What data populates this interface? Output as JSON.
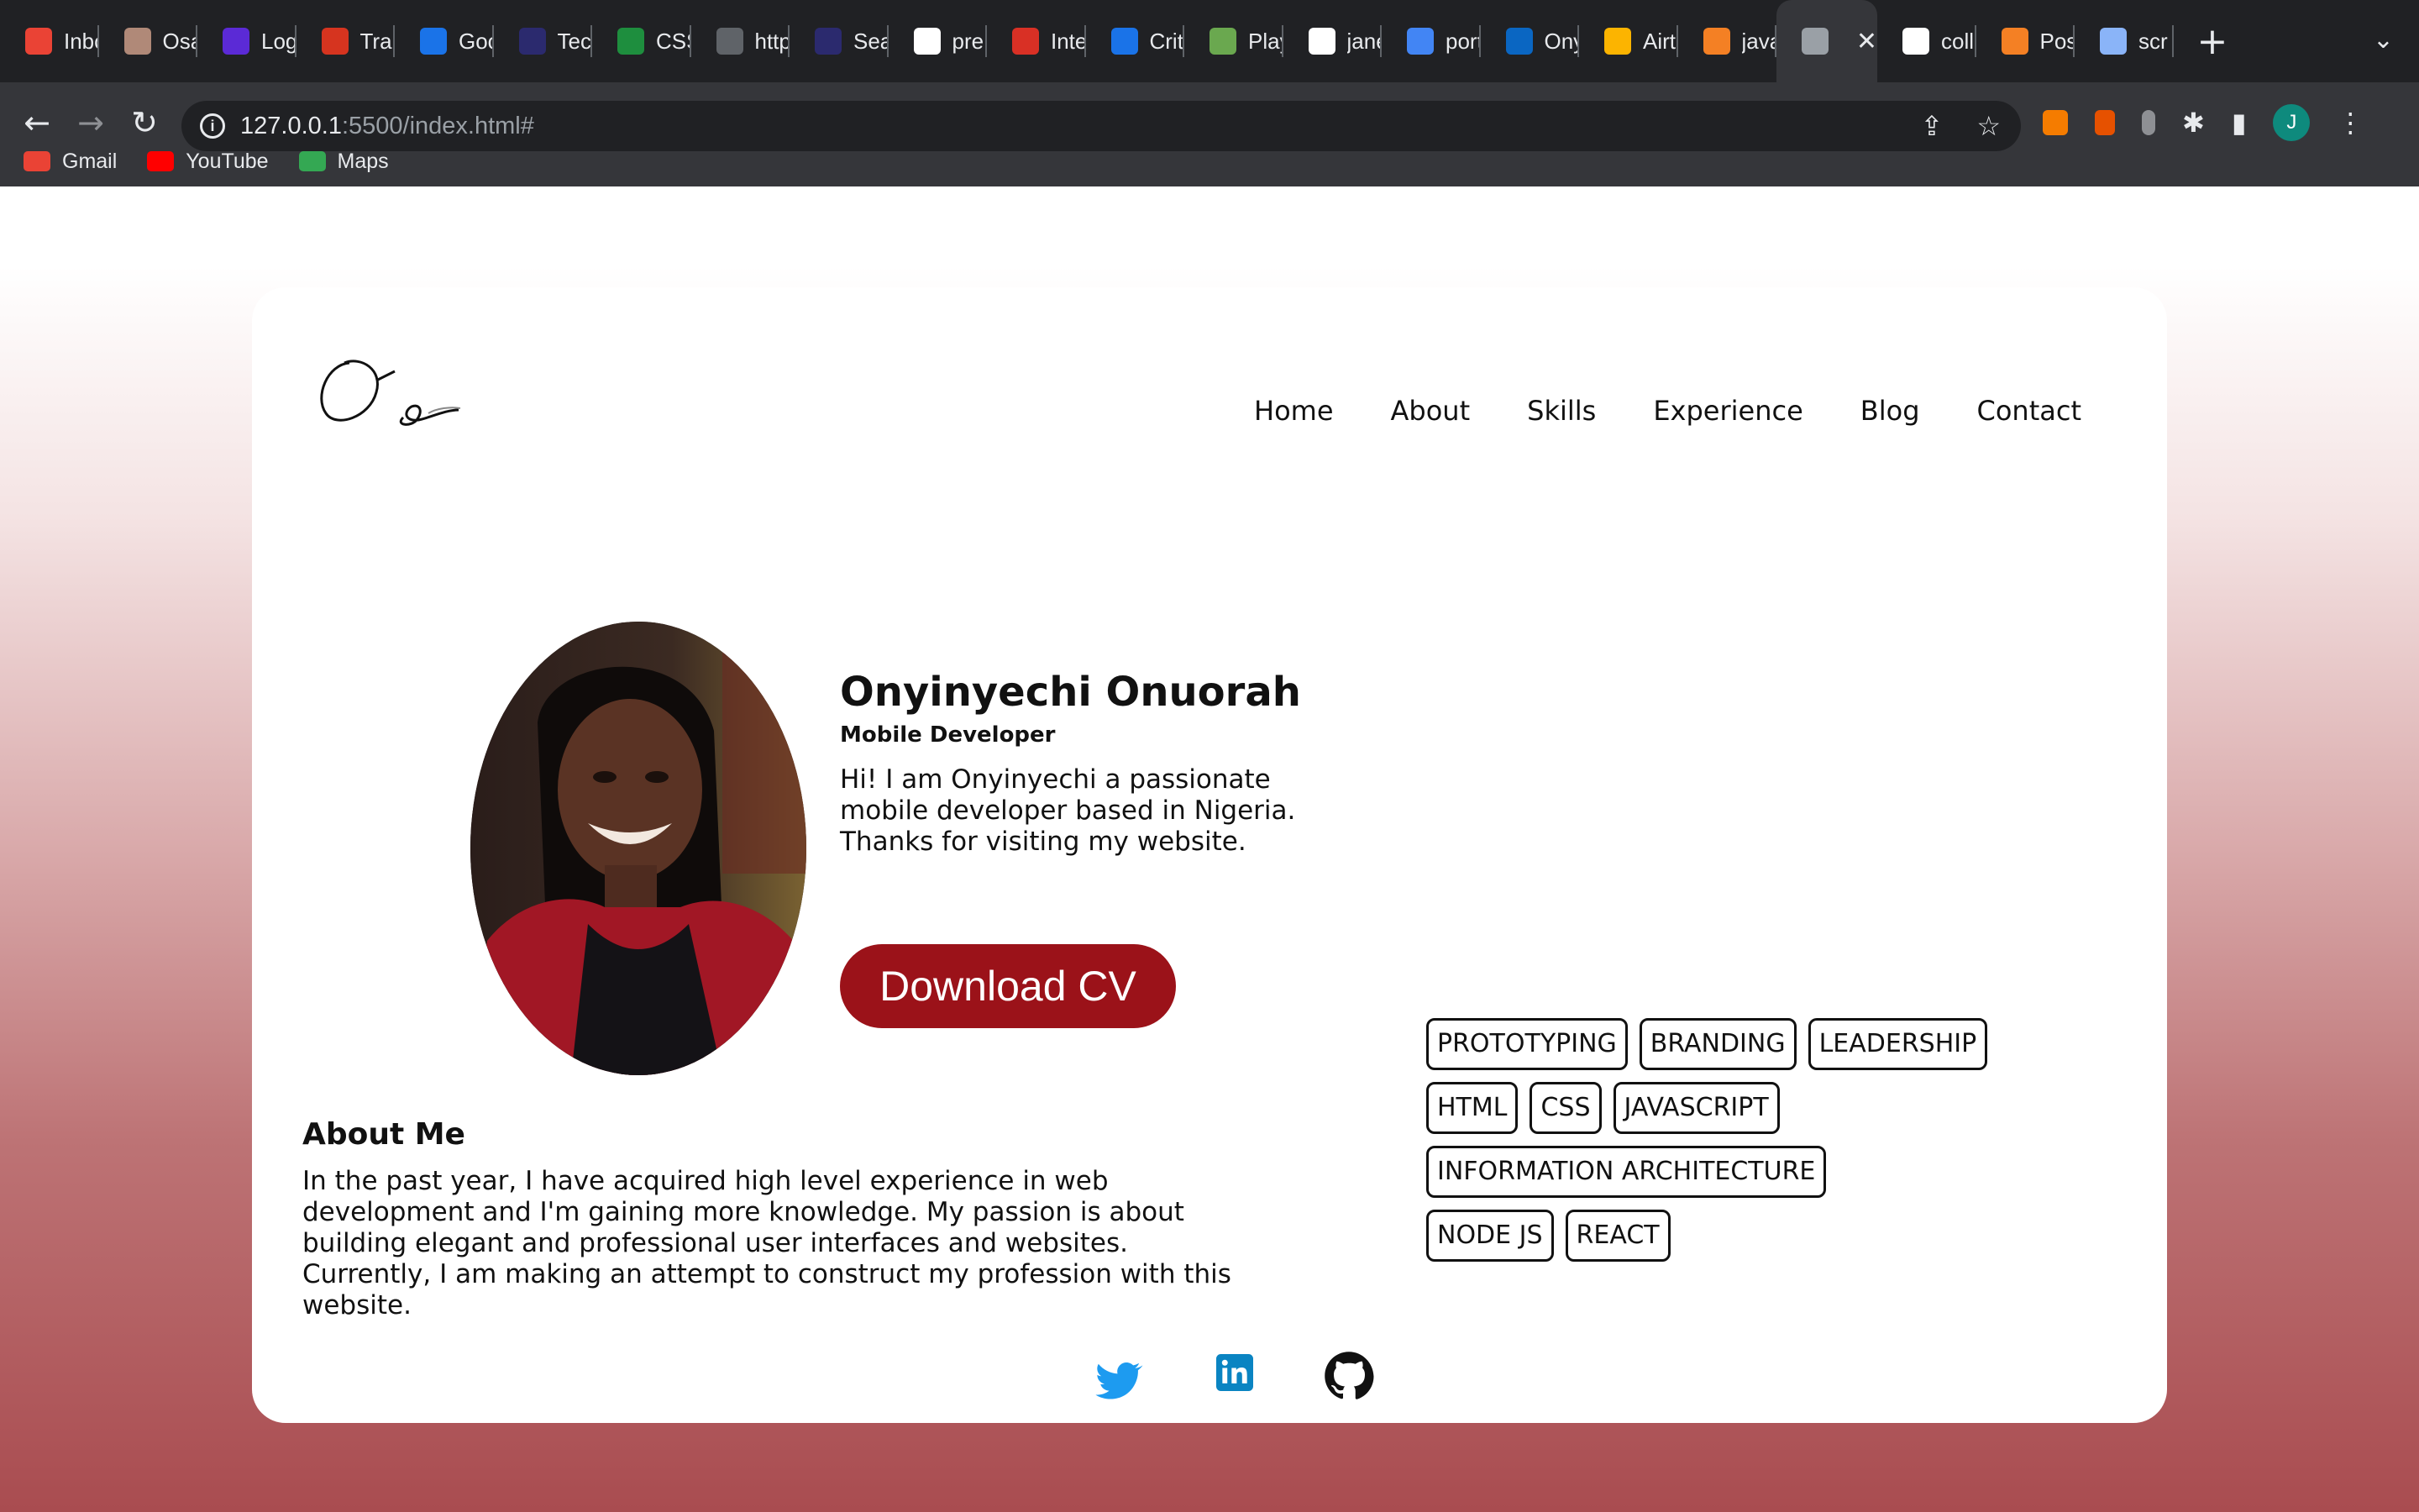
{
  "browser": {
    "tabs": [
      {
        "title": "Inbox",
        "icon": "gmail-icon",
        "color": "#ea4335"
      },
      {
        "title": "Osa",
        "icon": "profile-icon",
        "color": "#b08978"
      },
      {
        "title": "Log",
        "icon": "log-icon",
        "color": "#5b2ad6"
      },
      {
        "title": "Trai",
        "icon": "train-icon",
        "color": "#d6341f"
      },
      {
        "title": "Goo",
        "icon": "calendar-icon",
        "color": "#1a73e8"
      },
      {
        "title": "Tec",
        "icon": "tech-icon",
        "color": "#2b2a6e"
      },
      {
        "title": "CSS",
        "icon": "css-icon",
        "color": "#1e8e3e"
      },
      {
        "title": "http",
        "icon": "globe-icon",
        "color": "#5f6368"
      },
      {
        "title": "Sea",
        "icon": "search-icon",
        "color": "#2b2a6e"
      },
      {
        "title": "pre",
        "icon": "google-icon",
        "color": "#ffffff"
      },
      {
        "title": "Inte",
        "icon": "speedometer-icon",
        "color": "#d93025"
      },
      {
        "title": "Crit",
        "icon": "wave-icon",
        "color": "#1a73e8"
      },
      {
        "title": "Play",
        "icon": "chess-icon",
        "color": "#6aa84f"
      },
      {
        "title": "jane",
        "icon": "github-icon",
        "color": "#ffffff"
      },
      {
        "title": "port",
        "icon": "docs-icon",
        "color": "#4285f4"
      },
      {
        "title": "Ony",
        "icon": "linkedin-icon",
        "color": "#0a66c2"
      },
      {
        "title": "Airt",
        "icon": "airtable-icon",
        "color": "#fcb400"
      },
      {
        "title": "java",
        "icon": "stackoverflow-icon",
        "color": "#f48024"
      },
      {
        "title": "",
        "icon": "globe-icon",
        "color": "#9aa0a6",
        "active": true
      },
      {
        "title": "coll",
        "icon": "github-icon",
        "color": "#ffffff"
      },
      {
        "title": "Pos",
        "icon": "stackoverflow-icon",
        "color": "#f48024"
      },
      {
        "title": "scr",
        "icon": "loading-icon",
        "color": "#8ab4f8"
      }
    ],
    "url_host": "127.0.0.1",
    "url_path": ":5500/index.html#",
    "bookmarks": [
      {
        "label": "Gmail",
        "icon": "gmail-icon",
        "color": "#ea4335"
      },
      {
        "label": "YouTube",
        "icon": "youtube-icon",
        "color": "#ff0000"
      },
      {
        "label": "Maps",
        "icon": "maps-icon",
        "color": "#34a853"
      }
    ],
    "avatar_letter": "J",
    "new_tab_label": "+",
    "close_tab_label": "✕",
    "tab_search_label": "⌄"
  },
  "site": {
    "logo_text": "Oo",
    "nav": [
      "Home",
      "About",
      "Skills",
      "Experience",
      "Blog",
      "Contact"
    ],
    "hero": {
      "name": "Onyinyechi Onuorah",
      "role": "Mobile Developer",
      "bio": "Hi! I am Onyinyechi a passionate mobile developer based in Nigeria. Thanks for visiting my website.",
      "cv_button": "Download CV"
    },
    "about": {
      "heading": "About Me",
      "text": "In the past year, I have acquired high level experience in web development and I'm gaining more knowledge. My passion is about building elegant and professional user interfaces and websites. Currently, I am making an attempt to construct my profession with this website."
    },
    "skills": [
      [
        "PROTOTYPING",
        "BRANDING",
        "LEADERSHIP"
      ],
      [
        "HTML",
        "CSS",
        "JAVASCRIPT"
      ],
      [
        "INFORMATION ARCHITECTURE"
      ],
      [
        "NODE JS",
        "REACT"
      ]
    ],
    "socials": [
      {
        "name": "twitter-icon",
        "color": "#1d9bf0"
      },
      {
        "name": "linkedin-icon",
        "color": "#0a84c2"
      },
      {
        "name": "github-icon",
        "color": "#111111"
      }
    ],
    "colors": {
      "accent": "#9b1219",
      "text": "#111111"
    }
  }
}
